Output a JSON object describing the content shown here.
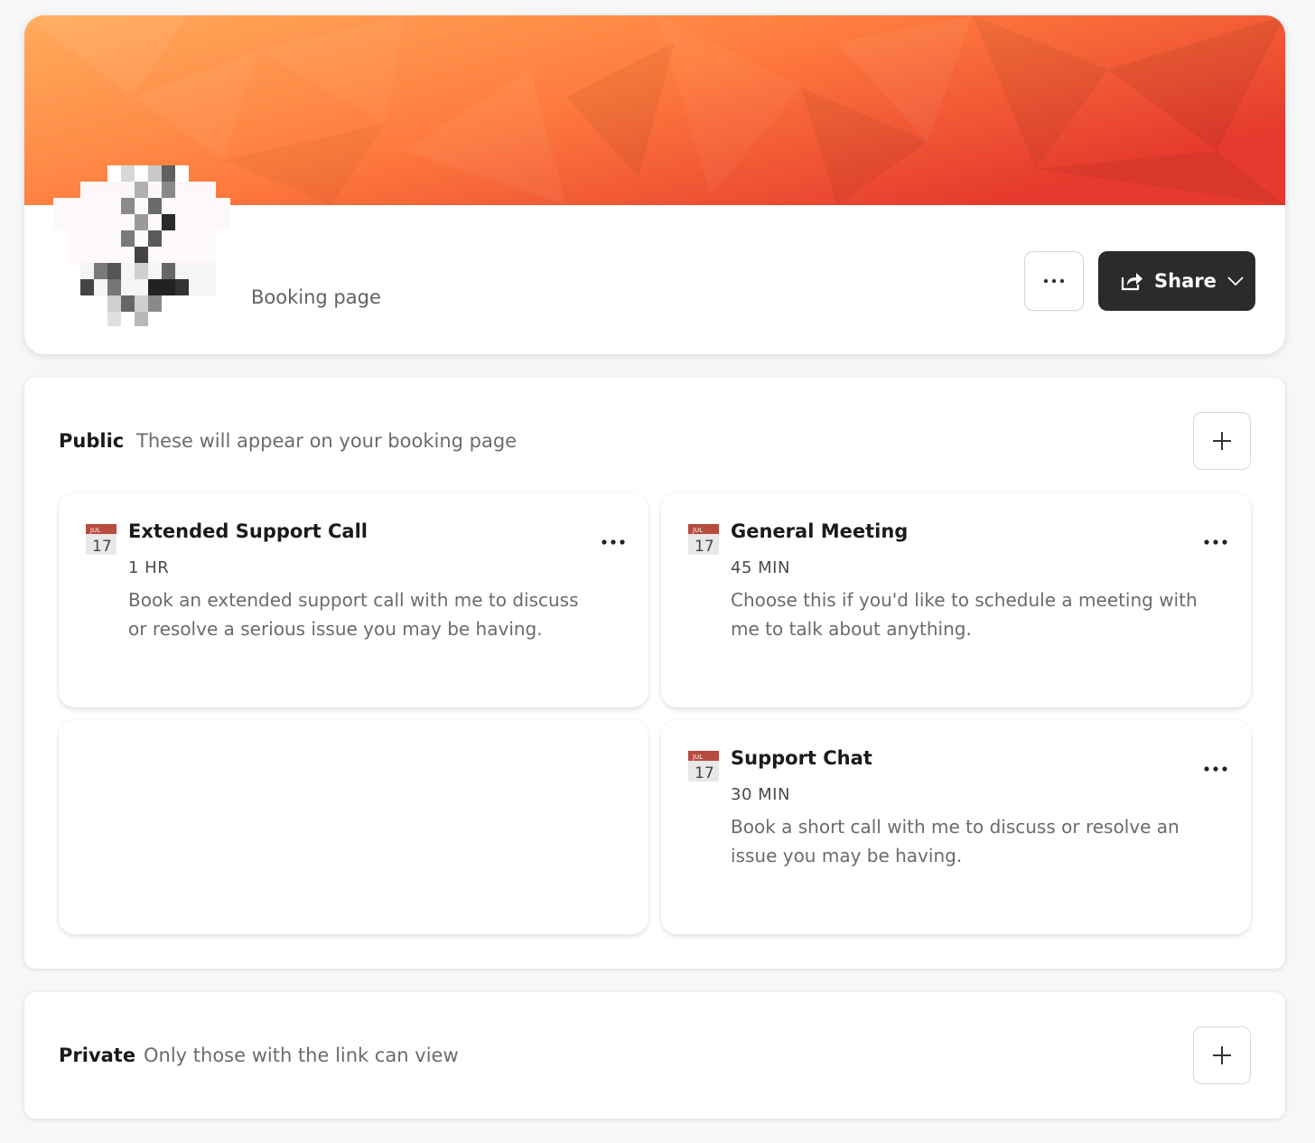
{
  "header": {
    "page_label": "Booking page",
    "share_label": "Share",
    "banner_colors": [
      "#ffa85a",
      "#ff7a3c",
      "#e83a2c"
    ]
  },
  "public": {
    "title": "Public",
    "description": "These will appear on your booking page",
    "events": [
      {
        "title": "Extended Support Call",
        "duration": "1 HR",
        "description": "Book an extended support call with me to discuss or resolve a serious issue you may be having.",
        "icon": "calendar-icon"
      },
      {
        "title": "General Meeting",
        "duration": "45 MIN",
        "description": "Choose this if you'd like to schedule a meeting with me to talk about anything.",
        "icon": "calendar-icon"
      },
      {
        "title": "Support Chat",
        "duration": "30 MIN",
        "description": "Book a short call with me to discuss or resolve an issue you may be having.",
        "icon": "calendar-icon"
      }
    ]
  },
  "private": {
    "title": "Private",
    "description": "Only those with the link can view"
  },
  "calendar_icon": {
    "month": "JUL",
    "day": "17"
  }
}
